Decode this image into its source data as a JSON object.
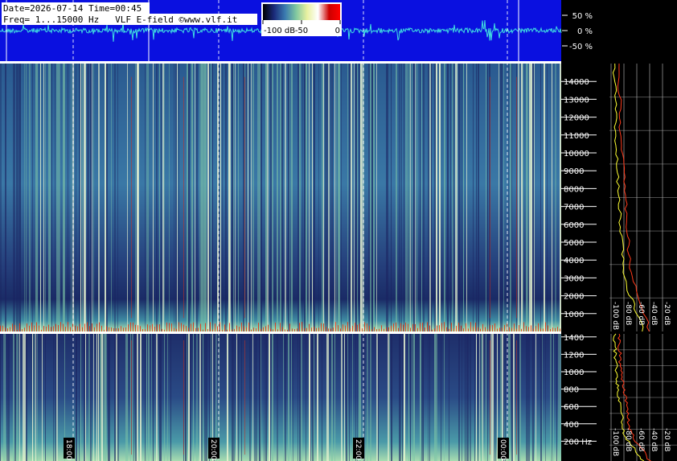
{
  "header": {
    "line1": "Date=2026-07-14 Time=00:45",
    "line2": "Freq= 1...15000 Hz   VLF E-field ©www.vlf.it"
  },
  "colorbar": {
    "tick_labels": [
      "-100 dB",
      "-50",
      "0"
    ],
    "stops": [
      "#000000",
      "#1a2a7a",
      "#3a7ab0",
      "#7fc7a0",
      "#e8f0a0",
      "#ffffff",
      "#cc0000",
      "#ff0000"
    ]
  },
  "colors": {
    "waveform_bg": "#0a10e0",
    "waveform_trace": "#40e0e0",
    "spectrogram_dark": "#1a2560",
    "spectrogram_mid": "#3a7aa8",
    "spectrogram_light": "#8ed0a8",
    "spectrum_peak": "#ff3a1a",
    "spectrum_avg": "#ffff33"
  },
  "chart_data": [
    {
      "type": "line",
      "panel": "waveform",
      "y_tick_labels": [
        "50 %",
        "0 %",
        "-50 %"
      ],
      "y_values": [
        50,
        0,
        -50
      ],
      "ylim": [
        -100,
        100
      ]
    },
    {
      "type": "heatmap",
      "panel": "spectrogram-upper",
      "ylim": [
        0,
        15000
      ],
      "y_ticks": [
        1000,
        2000,
        3000,
        4000,
        5000,
        6000,
        7000,
        8000,
        9000,
        10000,
        11000,
        12000,
        13000,
        14000
      ],
      "y_tick_labels": [
        "1000",
        "2000",
        "3000",
        "4000",
        "5000",
        "6000",
        "7000",
        "8000",
        "9000",
        "10000",
        "11000",
        "12000",
        "13000",
        "14000"
      ]
    },
    {
      "type": "heatmap",
      "panel": "spectrogram-lower",
      "ylim": [
        0,
        1500
      ],
      "y_ticks": [
        200,
        400,
        600,
        800,
        1000,
        1200,
        1400
      ],
      "y_tick_labels": [
        "200 Hz",
        "400",
        "600",
        "800",
        "1000",
        "1200",
        "1400"
      ]
    },
    {
      "type": "line",
      "panel": "time-axis",
      "x_ticks": [
        0.5,
        2.5,
        4.5,
        6.5
      ],
      "x_tick_labels": [
        "18:00",
        "20:00",
        "22:00",
        "00:00"
      ]
    },
    {
      "type": "line",
      "panel": "spectrum-profile",
      "x_tick_labels": [
        "-100 dB",
        "-80 dB",
        "-60 dB",
        "-40 dB",
        "-20 dB"
      ],
      "x_values": [
        -100,
        -80,
        -60,
        -40,
        -20
      ],
      "series": [
        {
          "color": "#ff3a1a",
          "values_db": [
            -40,
            -48,
            -60,
            -68,
            -72,
            -74,
            -76,
            -78,
            -80,
            -82,
            -84,
            -86,
            -86,
            -88,
            -88
          ]
        },
        {
          "color": "#ffff33",
          "values_db": [
            -50,
            -60,
            -72,
            -80,
            -82,
            -84,
            -86,
            -88,
            -90,
            -91,
            -92,
            -93,
            -94,
            -94,
            -95
          ]
        }
      ]
    }
  ]
}
